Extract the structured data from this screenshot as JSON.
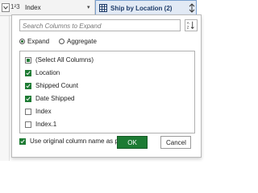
{
  "header": {
    "left_column": {
      "type_icon_label": "1²3",
      "name": "Index"
    },
    "right_column": {
      "name": "Ship by Location (2)"
    }
  },
  "dialog": {
    "search_placeholder": "Search Columns to Expand",
    "options": {
      "expand_label": "Expand",
      "aggregate_label": "Aggregate",
      "selected": "expand"
    },
    "columns": [
      {
        "label": "(Select All Columns)",
        "state": "partial"
      },
      {
        "label": "Location",
        "state": "checked"
      },
      {
        "label": "Shipped Count",
        "state": "checked"
      },
      {
        "label": "Date Shipped",
        "state": "checked"
      },
      {
        "label": "Index",
        "state": "unchecked"
      },
      {
        "label": "Index.1",
        "state": "unchecked"
      }
    ],
    "prefix_label": "Use original column name as prefix",
    "prefix_checked": true,
    "ok_label": "OK",
    "cancel_label": "Cancel"
  },
  "colors": {
    "accent": "#1e7b34",
    "header_highlight": "#e2eaf5"
  }
}
